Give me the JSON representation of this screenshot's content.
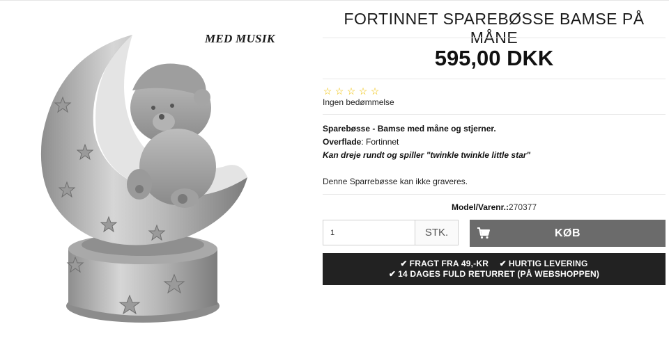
{
  "image": {
    "overlay_text": "MED MUSIK"
  },
  "product": {
    "title": "FORTINNET SPAREBØSSE BAMSE PÅ MÅNE",
    "price": "595,00 DKK",
    "rating": {
      "stars_filled": 0,
      "stars_total": 5,
      "text": "Ingen bedømmelse"
    },
    "description": {
      "line1": "Sparebøsse - Bamse med måne og stjerner.",
      "surface_label": "Overflade",
      "surface_value": ": Fortinnet",
      "line3": "Kan dreje rundt og spiller \"twinkle twinkle little star\"",
      "line4": "Denne Sparrebøsse kan ikke graveres."
    },
    "model": {
      "label": "Model/Varenr.:",
      "value": "270377"
    }
  },
  "cart": {
    "quantity": "1",
    "unit": "STK.",
    "buy_label": "KØB"
  },
  "usp": {
    "item1": "FRAGT FRA 49,-KR",
    "item2": "HURTIG LEVERING",
    "item3": "14 DAGES FULD RETURRET (PÅ WEBSHOPPEN)"
  },
  "colors": {
    "star": "#f0c000",
    "buy_button": "#6b6b6b",
    "usp_bar": "#222222"
  }
}
